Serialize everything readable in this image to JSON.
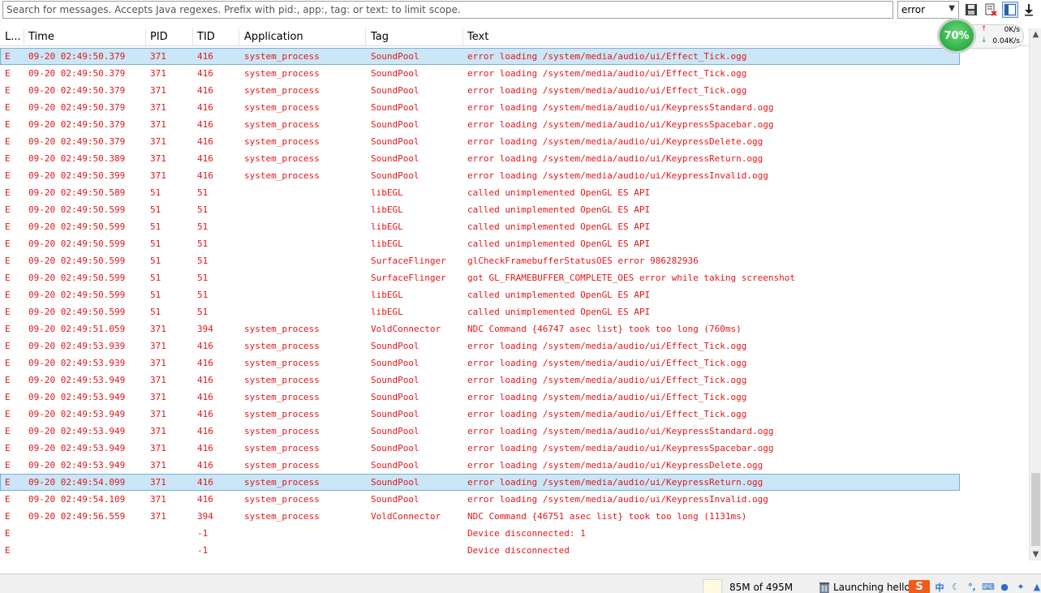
{
  "toolbar": {
    "search_placeholder": "Search for messages. Accepts Java regexes. Prefix with pid:, app:, tag: or text: to limit scope.",
    "level_value": "error",
    "icons": [
      "save-icon",
      "clear-log-icon",
      "toggle-panel-icon",
      "scroll-lock-icon"
    ]
  },
  "columns": [
    "L...",
    "Time",
    "PID",
    "TID",
    "Application",
    "Tag",
    "Text"
  ],
  "rows": [
    {
      "level": "E",
      "time": "09-20 02:49:50.379",
      "pid": "371",
      "tid": "416",
      "app": "system_process",
      "tag": "SoundPool",
      "text": "error loading /system/media/audio/ui/Effect_Tick.ogg",
      "selected": true
    },
    {
      "level": "E",
      "time": "09-20 02:49:50.379",
      "pid": "371",
      "tid": "416",
      "app": "system_process",
      "tag": "SoundPool",
      "text": "error loading /system/media/audio/ui/Effect_Tick.ogg"
    },
    {
      "level": "E",
      "time": "09-20 02:49:50.379",
      "pid": "371",
      "tid": "416",
      "app": "system_process",
      "tag": "SoundPool",
      "text": "error loading /system/media/audio/ui/Effect_Tick.ogg"
    },
    {
      "level": "E",
      "time": "09-20 02:49:50.379",
      "pid": "371",
      "tid": "416",
      "app": "system_process",
      "tag": "SoundPool",
      "text": "error loading /system/media/audio/ui/KeypressStandard.ogg"
    },
    {
      "level": "E",
      "time": "09-20 02:49:50.379",
      "pid": "371",
      "tid": "416",
      "app": "system_process",
      "tag": "SoundPool",
      "text": "error loading /system/media/audio/ui/KeypressSpacebar.ogg"
    },
    {
      "level": "E",
      "time": "09-20 02:49:50.379",
      "pid": "371",
      "tid": "416",
      "app": "system_process",
      "tag": "SoundPool",
      "text": "error loading /system/media/audio/ui/KeypressDelete.ogg"
    },
    {
      "level": "E",
      "time": "09-20 02:49:50.389",
      "pid": "371",
      "tid": "416",
      "app": "system_process",
      "tag": "SoundPool",
      "text": "error loading /system/media/audio/ui/KeypressReturn.ogg"
    },
    {
      "level": "E",
      "time": "09-20 02:49:50.399",
      "pid": "371",
      "tid": "416",
      "app": "system_process",
      "tag": "SoundPool",
      "text": "error loading /system/media/audio/ui/KeypressInvalid.ogg"
    },
    {
      "level": "E",
      "time": "09-20 02:49:50.589",
      "pid": "51",
      "tid": "51",
      "app": "",
      "tag": "libEGL",
      "text": "called unimplemented OpenGL ES API"
    },
    {
      "level": "E",
      "time": "09-20 02:49:50.599",
      "pid": "51",
      "tid": "51",
      "app": "",
      "tag": "libEGL",
      "text": "called unimplemented OpenGL ES API"
    },
    {
      "level": "E",
      "time": "09-20 02:49:50.599",
      "pid": "51",
      "tid": "51",
      "app": "",
      "tag": "libEGL",
      "text": "called unimplemented OpenGL ES API"
    },
    {
      "level": "E",
      "time": "09-20 02:49:50.599",
      "pid": "51",
      "tid": "51",
      "app": "",
      "tag": "libEGL",
      "text": "called unimplemented OpenGL ES API"
    },
    {
      "level": "E",
      "time": "09-20 02:49:50.599",
      "pid": "51",
      "tid": "51",
      "app": "",
      "tag": "SurfaceFlinger",
      "text": "glCheckFramebufferStatusOES error 986282936"
    },
    {
      "level": "E",
      "time": "09-20 02:49:50.599",
      "pid": "51",
      "tid": "51",
      "app": "",
      "tag": "SurfaceFlinger",
      "text": "got GL_FRAMEBUFFER_COMPLETE_OES error while taking screenshot"
    },
    {
      "level": "E",
      "time": "09-20 02:49:50.599",
      "pid": "51",
      "tid": "51",
      "app": "",
      "tag": "libEGL",
      "text": "called unimplemented OpenGL ES API"
    },
    {
      "level": "E",
      "time": "09-20 02:49:50.599",
      "pid": "51",
      "tid": "51",
      "app": "",
      "tag": "libEGL",
      "text": "called unimplemented OpenGL ES API"
    },
    {
      "level": "E",
      "time": "09-20 02:49:51.059",
      "pid": "371",
      "tid": "394",
      "app": "system_process",
      "tag": "VoldConnector",
      "text": "NDC Command {46747 asec list} took too long (760ms)"
    },
    {
      "level": "E",
      "time": "09-20 02:49:53.939",
      "pid": "371",
      "tid": "416",
      "app": "system_process",
      "tag": "SoundPool",
      "text": "error loading /system/media/audio/ui/Effect_Tick.ogg"
    },
    {
      "level": "E",
      "time": "09-20 02:49:53.939",
      "pid": "371",
      "tid": "416",
      "app": "system_process",
      "tag": "SoundPool",
      "text": "error loading /system/media/audio/ui/Effect_Tick.ogg"
    },
    {
      "level": "E",
      "time": "09-20 02:49:53.949",
      "pid": "371",
      "tid": "416",
      "app": "system_process",
      "tag": "SoundPool",
      "text": "error loading /system/media/audio/ui/Effect_Tick.ogg"
    },
    {
      "level": "E",
      "time": "09-20 02:49:53.949",
      "pid": "371",
      "tid": "416",
      "app": "system_process",
      "tag": "SoundPool",
      "text": "error loading /system/media/audio/ui/Effect_Tick.ogg"
    },
    {
      "level": "E",
      "time": "09-20 02:49:53.949",
      "pid": "371",
      "tid": "416",
      "app": "system_process",
      "tag": "SoundPool",
      "text": "error loading /system/media/audio/ui/Effect_Tick.ogg"
    },
    {
      "level": "E",
      "time": "09-20 02:49:53.949",
      "pid": "371",
      "tid": "416",
      "app": "system_process",
      "tag": "SoundPool",
      "text": "error loading /system/media/audio/ui/KeypressStandard.ogg"
    },
    {
      "level": "E",
      "time": "09-20 02:49:53.949",
      "pid": "371",
      "tid": "416",
      "app": "system_process",
      "tag": "SoundPool",
      "text": "error loading /system/media/audio/ui/KeypressSpacebar.ogg"
    },
    {
      "level": "E",
      "time": "09-20 02:49:53.949",
      "pid": "371",
      "tid": "416",
      "app": "system_process",
      "tag": "SoundPool",
      "text": "error loading /system/media/audio/ui/KeypressDelete.ogg"
    },
    {
      "level": "E",
      "time": "09-20 02:49:54.099",
      "pid": "371",
      "tid": "416",
      "app": "system_process",
      "tag": "SoundPool",
      "text": "error loading /system/media/audio/ui/KeypressReturn.ogg",
      "selected": true
    },
    {
      "level": "E",
      "time": "09-20 02:49:54.109",
      "pid": "371",
      "tid": "416",
      "app": "system_process",
      "tag": "SoundPool",
      "text": "error loading /system/media/audio/ui/KeypressInvalid.ogg"
    },
    {
      "level": "E",
      "time": "09-20 02:49:56.559",
      "pid": "371",
      "tid": "394",
      "app": "system_process",
      "tag": "VoldConnector",
      "text": "NDC Command {46751 asec list} took too long (1131ms)"
    },
    {
      "level": "E",
      "time": "",
      "pid": "",
      "tid": "-1",
      "app": "",
      "tag": "",
      "text": "Device disconnected: 1"
    },
    {
      "level": "E",
      "time": "",
      "pid": "",
      "tid": "-1",
      "app": "",
      "tag": "",
      "text": "Device disconnected"
    }
  ],
  "speed_widget": {
    "percent": "70%",
    "upload": "0K/s",
    "download": "0.04K/s"
  },
  "statusbar": {
    "heap": "85M of 495M",
    "launch": "Launching hello",
    "ime_logo": "S",
    "ime_lang": "中"
  },
  "colors": {
    "error_text": "#e0181b",
    "selected_row": "#cbe6f6",
    "gauge_green": "#2eb34a"
  }
}
